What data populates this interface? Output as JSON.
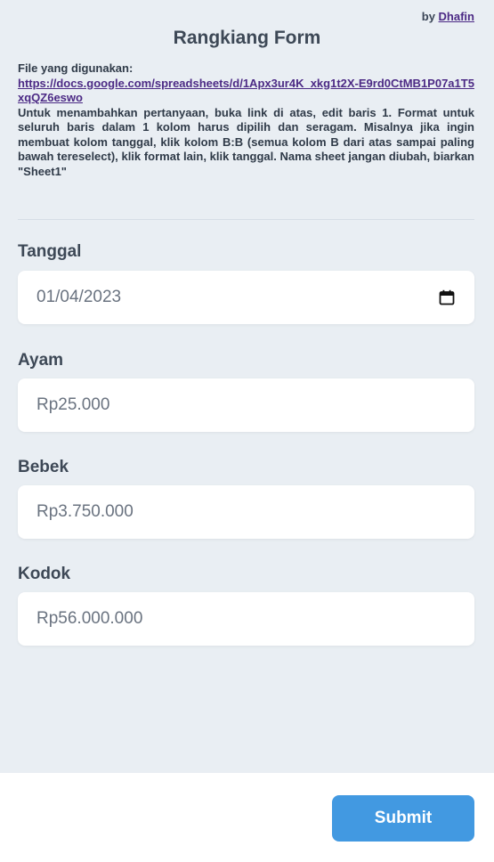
{
  "byline": {
    "prefix": "by",
    "author": "Dhafin"
  },
  "title": "Rangkiang Form",
  "info": {
    "label": "File yang digunakan:",
    "link": "https://docs.google.com/spreadsheets/d/1Apx3ur4K_xkg1t2X-E9rd0CtMB1P07a1T5xqQZ6eswo",
    "description": "Untuk menambahkan pertanyaan, buka link di atas, edit baris 1. Format untuk seluruh baris dalam 1 kolom harus dipilih dan seragam. Misalnya jika ingin membuat kolom tanggal, klik kolom B:B (semua kolom B dari atas sampai paling bawah tereselect), klik format lain, klik tanggal. Nama sheet jangan diubah, biarkan \"Sheet1\""
  },
  "fields": [
    {
      "label": "Tanggal",
      "value": "01/04/2023",
      "icon": "calendar-icon"
    },
    {
      "label": "Ayam",
      "placeholder": "Rp25.000"
    },
    {
      "label": "Bebek",
      "placeholder": "Rp3.750.000"
    },
    {
      "label": "Kodok",
      "placeholder": "Rp56.000.000"
    }
  ],
  "submit_label": "Submit",
  "colors": {
    "background": "#e9eef3",
    "accent": "#4299e1",
    "link": "#4c2a85",
    "text": "#3d4856"
  }
}
